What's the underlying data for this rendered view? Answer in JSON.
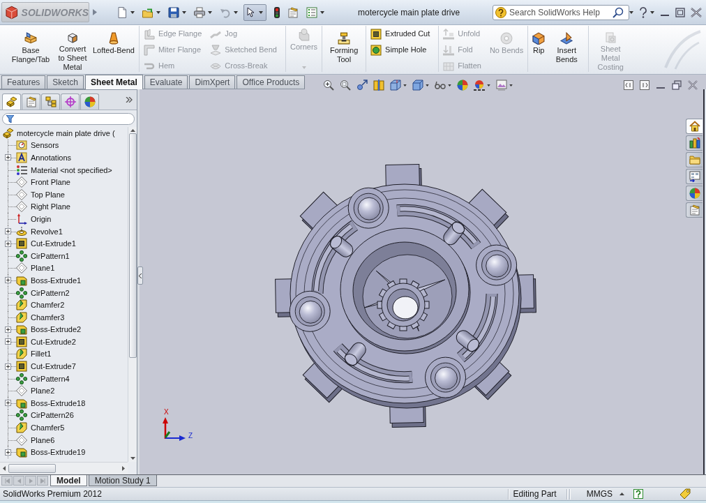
{
  "title_bar": {
    "logo_text": "SOLIDWORKS",
    "select_tool": {
      "pressed": true
    },
    "document_title": "motercycle main plate drive",
    "search": {
      "placeholder": "Search SolidWorks Help"
    }
  },
  "ribbon": {
    "groups": [
      {
        "columns": [
          {
            "kind": "large",
            "commands": [
              {
                "kind": "base-flange",
                "label": "Base Flange/Tab",
                "disabled": false,
                "has_menu": false
              }
            ]
          },
          {
            "kind": "large",
            "commands": [
              {
                "kind": "convert",
                "label": "Convert to Sheet Metal",
                "disabled": false,
                "has_menu": false
              }
            ]
          },
          {
            "kind": "large",
            "commands": [
              {
                "kind": "lofted-bend",
                "label": "Lofted-Bend",
                "disabled": false,
                "has_menu": false
              }
            ]
          }
        ]
      },
      {
        "columns": [
          {
            "kind": "stack",
            "commands": [
              {
                "kind": "edge-flange",
                "label": "Edge Flange",
                "disabled": true,
                "has_menu": false
              },
              {
                "kind": "miter-flange",
                "label": "Miter Flange",
                "disabled": true,
                "has_menu": false
              },
              {
                "kind": "hem",
                "label": "Hem",
                "disabled": true,
                "has_menu": false
              }
            ]
          },
          {
            "kind": "stack",
            "commands": [
              {
                "kind": "jog",
                "label": "Jog",
                "disabled": true,
                "has_menu": false
              },
              {
                "kind": "sketched-bend",
                "label": "Sketched Bend",
                "disabled": true,
                "has_menu": false
              },
              {
                "kind": "cross-break",
                "label": "Cross-Break",
                "disabled": true,
                "has_menu": false
              }
            ]
          }
        ]
      },
      {
        "columns": [
          {
            "kind": "large",
            "commands": [
              {
                "kind": "corners",
                "label": "Corners",
                "disabled": true,
                "has_menu": true
              }
            ]
          }
        ]
      },
      {
        "columns": [
          {
            "kind": "large",
            "commands": [
              {
                "kind": "forming-tool",
                "label": "Forming Tool",
                "disabled": false,
                "has_menu": false
              }
            ]
          }
        ]
      },
      {
        "columns": [
          {
            "kind": "stack",
            "commands": [
              {
                "kind": "extruded-cut",
                "label": "Extruded Cut",
                "disabled": false,
                "has_menu": false
              },
              {
                "kind": "simple-hole",
                "label": "Simple Hole",
                "disabled": false,
                "has_menu": false
              }
            ]
          }
        ]
      },
      {
        "columns": [
          {
            "kind": "stack",
            "commands": [
              {
                "kind": "unfold",
                "label": "Unfold",
                "disabled": true,
                "has_menu": false
              },
              {
                "kind": "fold",
                "label": "Fold",
                "disabled": true,
                "has_menu": false
              },
              {
                "kind": "flatten",
                "label": "Flatten",
                "disabled": true,
                "has_menu": false
              }
            ]
          },
          {
            "kind": "large",
            "commands": [
              {
                "kind": "no-bends",
                "label": "No Bends",
                "disabled": true,
                "has_menu": false
              }
            ]
          }
        ]
      },
      {
        "columns": [
          {
            "kind": "large",
            "commands": [
              {
                "kind": "rip",
                "label": "Rip",
                "disabled": false,
                "has_menu": false
              }
            ]
          },
          {
            "kind": "large",
            "commands": [
              {
                "kind": "insert-bends",
                "label": "Insert Bends",
                "disabled": false,
                "has_menu": false
              }
            ]
          }
        ]
      },
      {
        "columns": [
          {
            "kind": "large",
            "commands": [
              {
                "kind": "costing",
                "label": "Sheet Metal Costing",
                "disabled": true,
                "has_menu": false
              }
            ]
          }
        ]
      }
    ]
  },
  "command_tabs": [
    {
      "label": "Features",
      "selected": false
    },
    {
      "label": "Sketch",
      "selected": false
    },
    {
      "label": "Sheet Metal",
      "selected": true
    },
    {
      "label": "Evaluate",
      "selected": false
    },
    {
      "label": "DimXpert",
      "selected": false
    },
    {
      "label": "Office Products",
      "selected": false
    }
  ],
  "panel_tabs": [
    {
      "kind": "feature-manager",
      "selected": true
    },
    {
      "kind": "property-manager",
      "selected": false
    },
    {
      "kind": "configuration-manager",
      "selected": false
    },
    {
      "kind": "dimxpert-manager",
      "selected": false
    },
    {
      "kind": "display-manager",
      "selected": false
    }
  ],
  "feature_tree": {
    "root": {
      "kind": "part",
      "label": "motercycle main plate drive ("
    },
    "items": [
      {
        "kind": "sensors",
        "label": "Sensors",
        "expandable": false
      },
      {
        "kind": "annotations",
        "label": "Annotations",
        "expandable": true
      },
      {
        "kind": "material",
        "label": "Material <not specified>",
        "expandable": false
      },
      {
        "kind": "plane",
        "label": "Front Plane",
        "expandable": false
      },
      {
        "kind": "plane",
        "label": "Top Plane",
        "expandable": false
      },
      {
        "kind": "plane",
        "label": "Right Plane",
        "expandable": false
      },
      {
        "kind": "origin",
        "label": "Origin",
        "expandable": false
      },
      {
        "kind": "revolve",
        "label": "Revolve1",
        "expandable": true
      },
      {
        "kind": "cut-extrude",
        "label": "Cut-Extrude1",
        "expandable": true
      },
      {
        "kind": "pattern",
        "label": "CirPattern1",
        "expandable": false
      },
      {
        "kind": "plane",
        "label": "Plane1",
        "expandable": false
      },
      {
        "kind": "boss-extrude",
        "label": "Boss-Extrude1",
        "expandable": true
      },
      {
        "kind": "pattern",
        "label": "CirPattern2",
        "expandable": false
      },
      {
        "kind": "chamfer",
        "label": "Chamfer2",
        "expandable": false
      },
      {
        "kind": "chamfer",
        "label": "Chamfer3",
        "expandable": false
      },
      {
        "kind": "boss-extrude",
        "label": "Boss-Extrude2",
        "expandable": true
      },
      {
        "kind": "cut-extrude",
        "label": "Cut-Extrude2",
        "expandable": true
      },
      {
        "kind": "fillet",
        "label": "Fillet1",
        "expandable": false
      },
      {
        "kind": "cut-extrude",
        "label": "Cut-Extrude7",
        "expandable": true
      },
      {
        "kind": "pattern",
        "label": "CirPattern4",
        "expandable": false
      },
      {
        "kind": "plane",
        "label": "Plane2",
        "expandable": false
      },
      {
        "kind": "boss-extrude",
        "label": "Boss-Extrude18",
        "expandable": true
      },
      {
        "kind": "pattern",
        "label": "CirPattern26",
        "expandable": false
      },
      {
        "kind": "chamfer",
        "label": "Chamfer5",
        "expandable": false
      },
      {
        "kind": "plane",
        "label": "Plane6",
        "expandable": false
      },
      {
        "kind": "boss-extrude",
        "label": "Boss-Extrude19",
        "expandable": true
      }
    ]
  },
  "task_pane": [
    {
      "kind": "home",
      "selected": true
    },
    {
      "kind": "design-library",
      "selected": false
    },
    {
      "kind": "file-explorer",
      "selected": false
    },
    {
      "kind": "view-palette",
      "selected": false
    },
    {
      "kind": "appearances",
      "selected": false
    },
    {
      "kind": "custom-properties",
      "selected": false
    }
  ],
  "triad": {
    "x_label": "X",
    "z_label": "Z"
  },
  "model_tabs": [
    {
      "label": "Model",
      "selected": true
    },
    {
      "label": "Motion Study 1",
      "selected": false
    }
  ],
  "status_bar": {
    "product": "SolidWorks Premium 2012",
    "mode": "Editing Part",
    "units": "MMGS"
  }
}
